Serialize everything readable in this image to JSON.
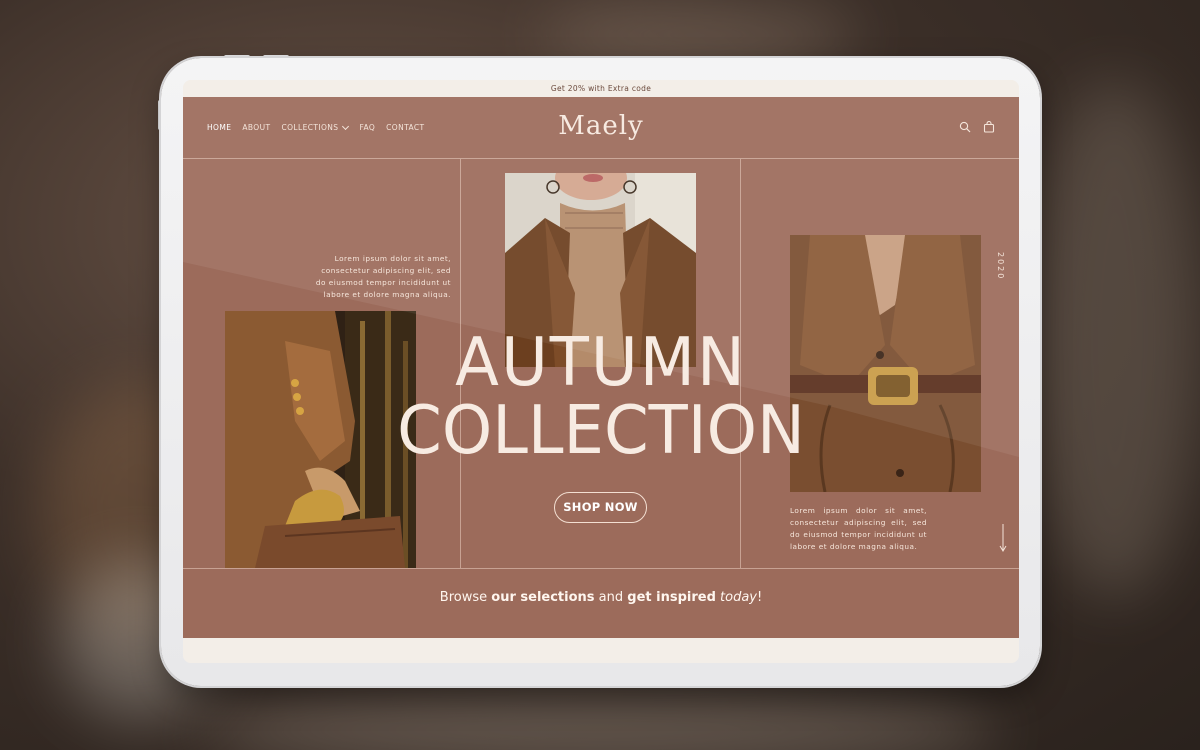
{
  "announcement": "Get 20% with Extra code",
  "brand": {
    "logo_text": "Maely"
  },
  "nav": {
    "items": [
      {
        "label": "HOME",
        "active": true
      },
      {
        "label": "ABOUT"
      },
      {
        "label": "COLLECTIONS",
        "has_dropdown": true
      },
      {
        "label": "FAQ"
      },
      {
        "label": "CONTACT"
      }
    ]
  },
  "header_icons": [
    "search-icon",
    "cart-icon"
  ],
  "hero": {
    "headline_line1": "AUTUMN",
    "headline_line2": "COLLECTION",
    "cta_label": "SHOP NOW",
    "year_vertical": "2020",
    "paragraph_left": "Lorem ipsum dolor sit amet, consectetur adipiscing elit, sed do eiusmod tempor incididunt ut labore et dolore magna aliqua.",
    "paragraph_right": "Lorem ipsum dolor sit amet, consectetur adipiscing elit, sed do eiusmod tempor incididunt ut labore et dolore magna aliqua."
  },
  "tagline": {
    "part1": "Browse ",
    "part2": "our selections",
    "part3": " and ",
    "part4": "get inspired",
    "part5": " ",
    "part6": "today",
    "part7": "!"
  },
  "colors": {
    "site_background": "#9c6b5b",
    "cream": "#f3eee8",
    "text_light": "#f7ebe2"
  }
}
